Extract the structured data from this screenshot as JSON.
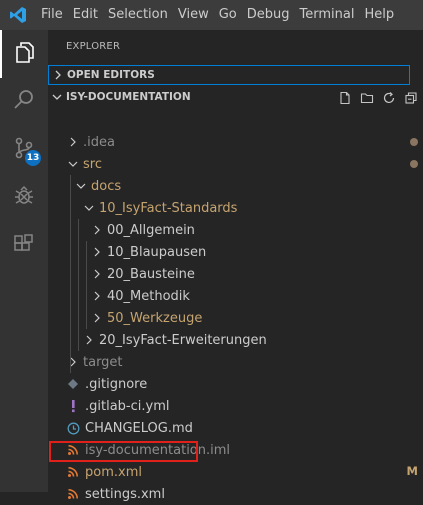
{
  "menu": [
    "File",
    "Edit",
    "Selection",
    "View",
    "Go",
    "Debug",
    "Terminal",
    "Help"
  ],
  "activity_bar": {
    "items": [
      {
        "name": "files-icon"
      },
      {
        "name": "search-icon"
      },
      {
        "name": "source-control-icon",
        "badge": "13"
      },
      {
        "name": "debug-icon"
      },
      {
        "name": "extensions-icon"
      }
    ]
  },
  "explorer": {
    "title": "EXPLORER",
    "open_editors": "OPEN EDITORS",
    "project": "ISY-DOCUMENTATION",
    "project_actions": [
      "new-file-icon",
      "new-folder-icon",
      "refresh-icon",
      "collapse-all-icon"
    ]
  },
  "tree": [
    {
      "label": ".idea",
      "depth": 0,
      "type": "folder",
      "expanded": false,
      "color": "#8c8c8c",
      "decoration": "dot"
    },
    {
      "label": "src",
      "depth": 0,
      "type": "folder",
      "expanded": true,
      "color": "#c6a46f",
      "decoration": "dot"
    },
    {
      "label": "docs",
      "depth": 1,
      "type": "folder",
      "expanded": true,
      "color": "#c6a46f",
      "decoration": "none"
    },
    {
      "label": "10_IsyFact-Standards",
      "depth": 2,
      "type": "folder",
      "expanded": true,
      "color": "#c6a46f",
      "decoration": "dot"
    },
    {
      "label": "00_Allgemein",
      "depth": 3,
      "type": "folder",
      "expanded": false,
      "color": "#cccccc",
      "decoration": "none"
    },
    {
      "label": "10_Blaupausen",
      "depth": 3,
      "type": "folder",
      "expanded": false,
      "color": "#cccccc",
      "decoration": "none"
    },
    {
      "label": "20_Bausteine",
      "depth": 3,
      "type": "folder",
      "expanded": false,
      "color": "#cccccc",
      "decoration": "none"
    },
    {
      "label": "40_Methodik",
      "depth": 3,
      "type": "folder",
      "expanded": false,
      "color": "#cccccc",
      "decoration": "none"
    },
    {
      "label": "50_Werkzeuge",
      "depth": 3,
      "type": "folder",
      "expanded": false,
      "color": "#c6a46f",
      "decoration": "dot"
    },
    {
      "label": "20_IsyFact-Erweiterungen",
      "depth": 2,
      "type": "folder",
      "expanded": false,
      "color": "#cccccc",
      "decoration": "none"
    },
    {
      "label": "target",
      "depth": 0,
      "type": "folder",
      "expanded": false,
      "color": "#8c8c8c",
      "decoration": "none"
    },
    {
      "label": ".gitignore",
      "depth": 0,
      "type": "file",
      "icon": "git-icon",
      "color": "#cccccc",
      "decoration": "none"
    },
    {
      "label": ".gitlab-ci.yml",
      "depth": 0,
      "type": "file",
      "icon": "yaml-icon",
      "color": "#cccccc",
      "decoration": "none"
    },
    {
      "label": "CHANGELOG.md",
      "depth": 0,
      "type": "file",
      "icon": "markdown-icon",
      "color": "#cccccc",
      "decoration": "none"
    },
    {
      "label": "isy-documentation.iml",
      "depth": 0,
      "type": "file",
      "icon": "rss-icon",
      "color": "#8c8c8c",
      "decoration": "none"
    },
    {
      "label": "pom.xml",
      "depth": 0,
      "type": "file",
      "icon": "rss-icon",
      "color": "#c6a46f",
      "decoration": "M"
    },
    {
      "label": "settings.xml",
      "depth": 0,
      "type": "file",
      "icon": "rss-icon",
      "color": "#cccccc",
      "decoration": "none"
    }
  ]
}
